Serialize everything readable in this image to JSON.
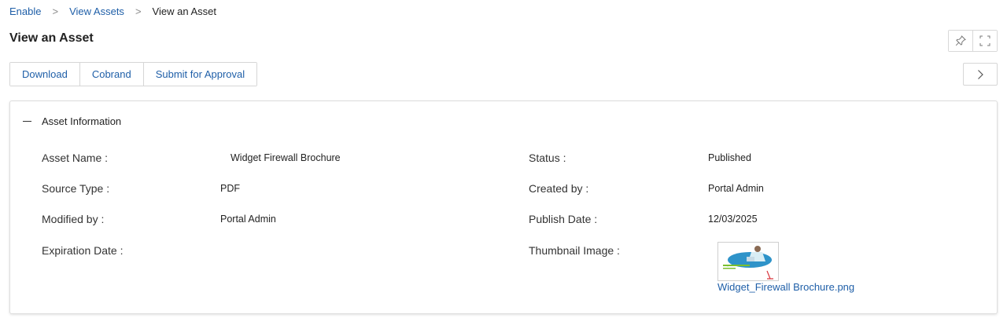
{
  "breadcrumb": {
    "items": [
      "Enable",
      "View Assets",
      "View an Asset"
    ]
  },
  "page": {
    "title": "View an Asset"
  },
  "toolbar": {
    "download_label": "Download",
    "cobrand_label": "Cobrand",
    "submit_label": "Submit for Approval"
  },
  "icons": {
    "pin": "pin-icon",
    "fullscreen": "fullscreen-icon",
    "next": "chevron-right-icon",
    "collapse": "minus-icon"
  },
  "section": {
    "title": "Asset Information"
  },
  "fields": {
    "asset_name": {
      "label": "Asset Name :",
      "value": "Widget Firewall Brochure"
    },
    "source_type": {
      "label": "Source Type :",
      "value": "PDF"
    },
    "modified_by": {
      "label": "Modified by :",
      "value": "Portal Admin"
    },
    "expiration_date": {
      "label": "Expiration Date :",
      "value": ""
    },
    "status": {
      "label": "Status :",
      "value": "Published"
    },
    "created_by": {
      "label": "Created by :",
      "value": "Portal Admin"
    },
    "publish_date": {
      "label": "Publish Date :",
      "value": "12/03/2025"
    },
    "thumbnail_image": {
      "label": "Thumbnail Image :",
      "file_name": "Widget_Firewall Brochure.png",
      "thumb_caption": "Widget Firewall"
    }
  },
  "colors": {
    "link": "#1f5fa8",
    "text": "#222222",
    "border": "#d6d6d6"
  }
}
